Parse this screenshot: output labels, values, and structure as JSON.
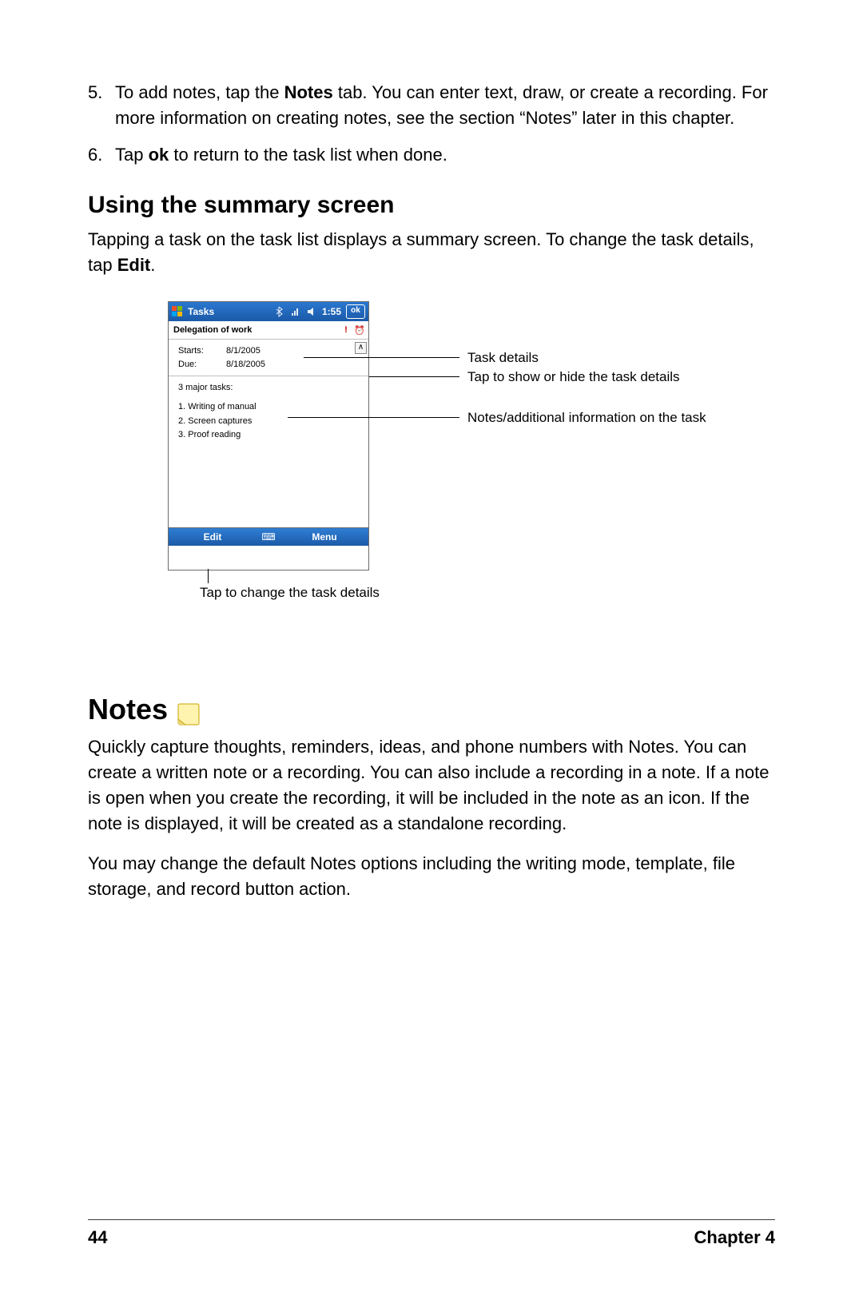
{
  "steps": {
    "s5_num": "5.",
    "s5_a": "To add notes, tap the ",
    "s5_b_bold": "Notes",
    "s5_c": " tab. You can enter text, draw, or create a recording. For more information on creating notes, see the section “Notes” later in this chapter.",
    "s6_num": "6.",
    "s6_a": "Tap ",
    "s6_b_bold": "ok",
    "s6_c": " to return to the task list when done."
  },
  "section_heading": "Using the summary screen",
  "section_intro_a": "Tapping a task on the task list displays a summary screen. To change the task details, tap ",
  "section_intro_b_bold": "Edit",
  "section_intro_c": ".",
  "phone": {
    "title": "Tasks",
    "time": "1:55",
    "ok": "ok",
    "subject": "Delegation of work",
    "prio_excl": "!",
    "prio_clock": "⏰",
    "starts_label": "Starts:",
    "starts_value": "8/1/2005",
    "due_label": "Due:",
    "due_value": "8/18/2005",
    "body_title": "3 major tasks:",
    "body_item1": "1. Writing of manual",
    "body_item2": "2. Screen captures",
    "body_item3": "3. Proof reading",
    "toggle": "∧",
    "btn_edit": "Edit",
    "btn_mid": "⌨",
    "btn_menu": "Menu"
  },
  "callout_details": "Task details",
  "callout_showhide": "Tap to show or hide the task details",
  "callout_notesinfo": "Notes/additional information on the task",
  "caption_edit": "Tap to change the task details",
  "notes_heading": "Notes",
  "notes_p1": "Quickly capture thoughts, reminders, ideas, and phone numbers with Notes. You can create a written note or a recording. You can also include a recording in a note. If a note is open when you create the recording, it will be included in the note as an icon. If the note is displayed, it will be created as a standalone recording.",
  "notes_p2": "You may change the default Notes options including the writing mode, template, file storage, and record button action.",
  "footer_page": "44",
  "footer_chapter": "Chapter 4"
}
